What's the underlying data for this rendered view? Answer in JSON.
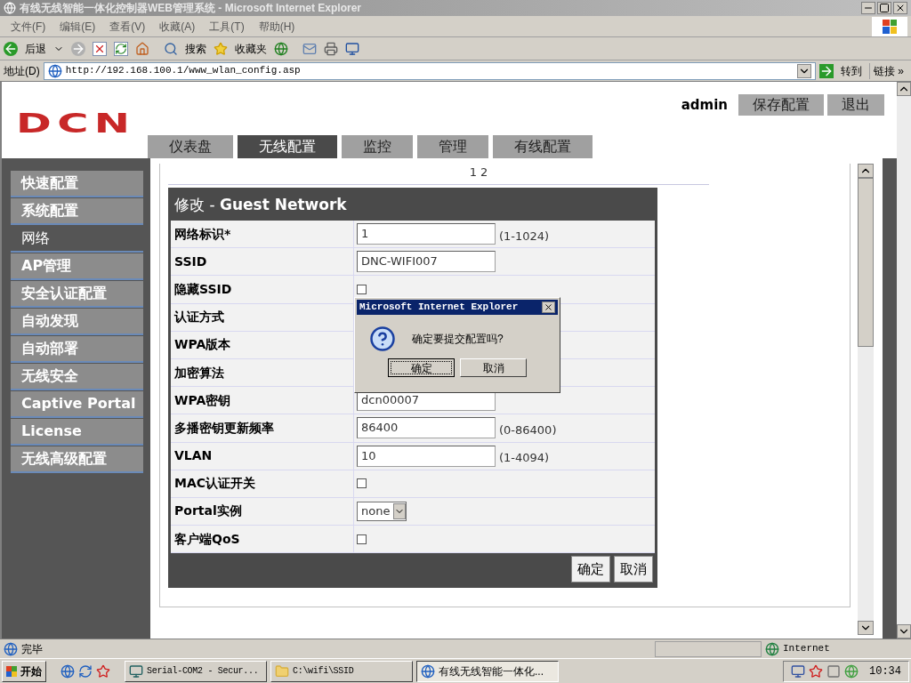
{
  "window": {
    "title": "有线无线智能一体化控制器WEB管理系统 - Microsoft Internet Explorer"
  },
  "menu": [
    "文件(F)",
    "编辑(E)",
    "查看(V)",
    "收藏(A)",
    "工具(T)",
    "帮助(H)"
  ],
  "toolbar": {
    "back": "后退",
    "search": "搜索",
    "favorites": "收藏夹"
  },
  "address_bar": {
    "label": "地址(D)",
    "url": "http://192.168.100.1/www_wlan_config.asp",
    "go": "转到",
    "links": "链接 »"
  },
  "page": {
    "logo": "DCN",
    "user": "admin",
    "header_buttons": [
      "保存配置",
      "退出"
    ],
    "tabs": [
      {
        "label": "仪表盘",
        "selected": false
      },
      {
        "label": "无线配置",
        "selected": true
      },
      {
        "label": "监控",
        "selected": false
      },
      {
        "label": "管理",
        "selected": false
      },
      {
        "label": "有线配置",
        "selected": false
      }
    ],
    "sidebar": [
      {
        "label": "快速配置",
        "selected": false
      },
      {
        "label": "系统配置",
        "selected": false
      },
      {
        "label": "网络",
        "selected": true
      },
      {
        "label": "AP管理",
        "selected": false
      },
      {
        "label": "安全认证配置",
        "selected": false
      },
      {
        "label": "自动发现",
        "selected": false
      },
      {
        "label": "自动部署",
        "selected": false
      },
      {
        "label": "无线安全",
        "selected": false
      },
      {
        "label": "Captive Portal",
        "selected": false
      },
      {
        "label": "License",
        "selected": false
      },
      {
        "label": "无线高级配置",
        "selected": false
      }
    ],
    "pagination": "1 2",
    "form": {
      "title": "修改 - **Guest Network**",
      "rows": [
        {
          "label": "网络标识*",
          "kind": "text",
          "value": "1",
          "hint": "(1-1024)"
        },
        {
          "label": "SSID",
          "kind": "text",
          "value": "DNC-WIFI007"
        },
        {
          "label": "隐藏SSID",
          "kind": "checkbox",
          "checked": false
        },
        {
          "label": "认证方式",
          "kind": "covered"
        },
        {
          "label": "WPA版本",
          "kind": "covered"
        },
        {
          "label": "加密算法",
          "kind": "covered"
        },
        {
          "label": "WPA密钥",
          "kind": "text",
          "value": "dcn00007"
        },
        {
          "label": "多播密钥更新频率",
          "kind": "text",
          "value": "86400",
          "hint": "(0-86400)"
        },
        {
          "label": "VLAN",
          "kind": "text",
          "value": "10",
          "hint": "(1-4094)"
        },
        {
          "label": "MAC认证开关",
          "kind": "checkbox",
          "checked": false
        },
        {
          "label": "Portal实例",
          "kind": "select",
          "value": "none"
        },
        {
          "label": "客户端QoS",
          "kind": "checkbox",
          "checked": false
        }
      ],
      "buttons": [
        "确定",
        "取消"
      ]
    }
  },
  "dialog": {
    "title": "Microsoft Internet Explorer",
    "message": "确定要提交配置吗?",
    "buttons": [
      {
        "label": "确定",
        "focused": true
      },
      {
        "label": "取消",
        "focused": false
      }
    ]
  },
  "status_bar": {
    "text": "完毕",
    "zone": "Internet"
  },
  "taskbar": {
    "start": "开始",
    "tasks": [
      {
        "label": "Serial-COM2 - Secur...",
        "selected": false
      },
      {
        "label": "C:\\wifi\\SSID",
        "selected": false
      },
      {
        "label": "有线无线智能一体化...",
        "selected": true
      }
    ],
    "clock": "10:34"
  }
}
